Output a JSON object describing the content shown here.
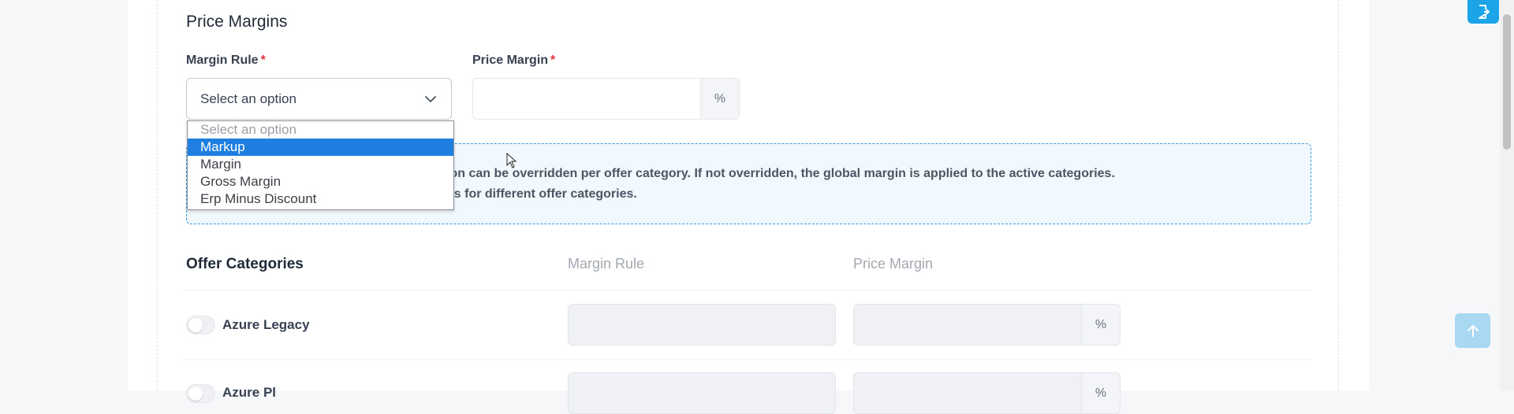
{
  "section": {
    "title": "Price Margins"
  },
  "margin_rule": {
    "label": "Margin Rule",
    "required_mark": "*",
    "selected_text": "Select an option",
    "options": [
      "Select an option",
      "Markup",
      "Margin",
      "Gross Margin",
      "Erp Minus Discount"
    ],
    "highlighted_option": "Markup"
  },
  "price_margin": {
    "label": "Price Margin",
    "required_mark": "*",
    "value": "",
    "unit": "%"
  },
  "info": {
    "line1": "ion can be overridden per offer category. If not overridden, the global margin is applied to the active categories.",
    "line2": "ns for different offer categories."
  },
  "offer_categories": {
    "title": "Offer Categories",
    "col_margin_rule": "Margin Rule",
    "col_price_margin": "Price Margin",
    "rows": [
      {
        "name": "Azure Legacy",
        "enabled": false,
        "unit": "%"
      },
      {
        "name": "Azure Pl",
        "enabled": false,
        "unit": "%"
      }
    ]
  },
  "colors": {
    "accent": "#1e7fe0",
    "info_border": "#3a9ad9",
    "required": "#e0333c"
  }
}
